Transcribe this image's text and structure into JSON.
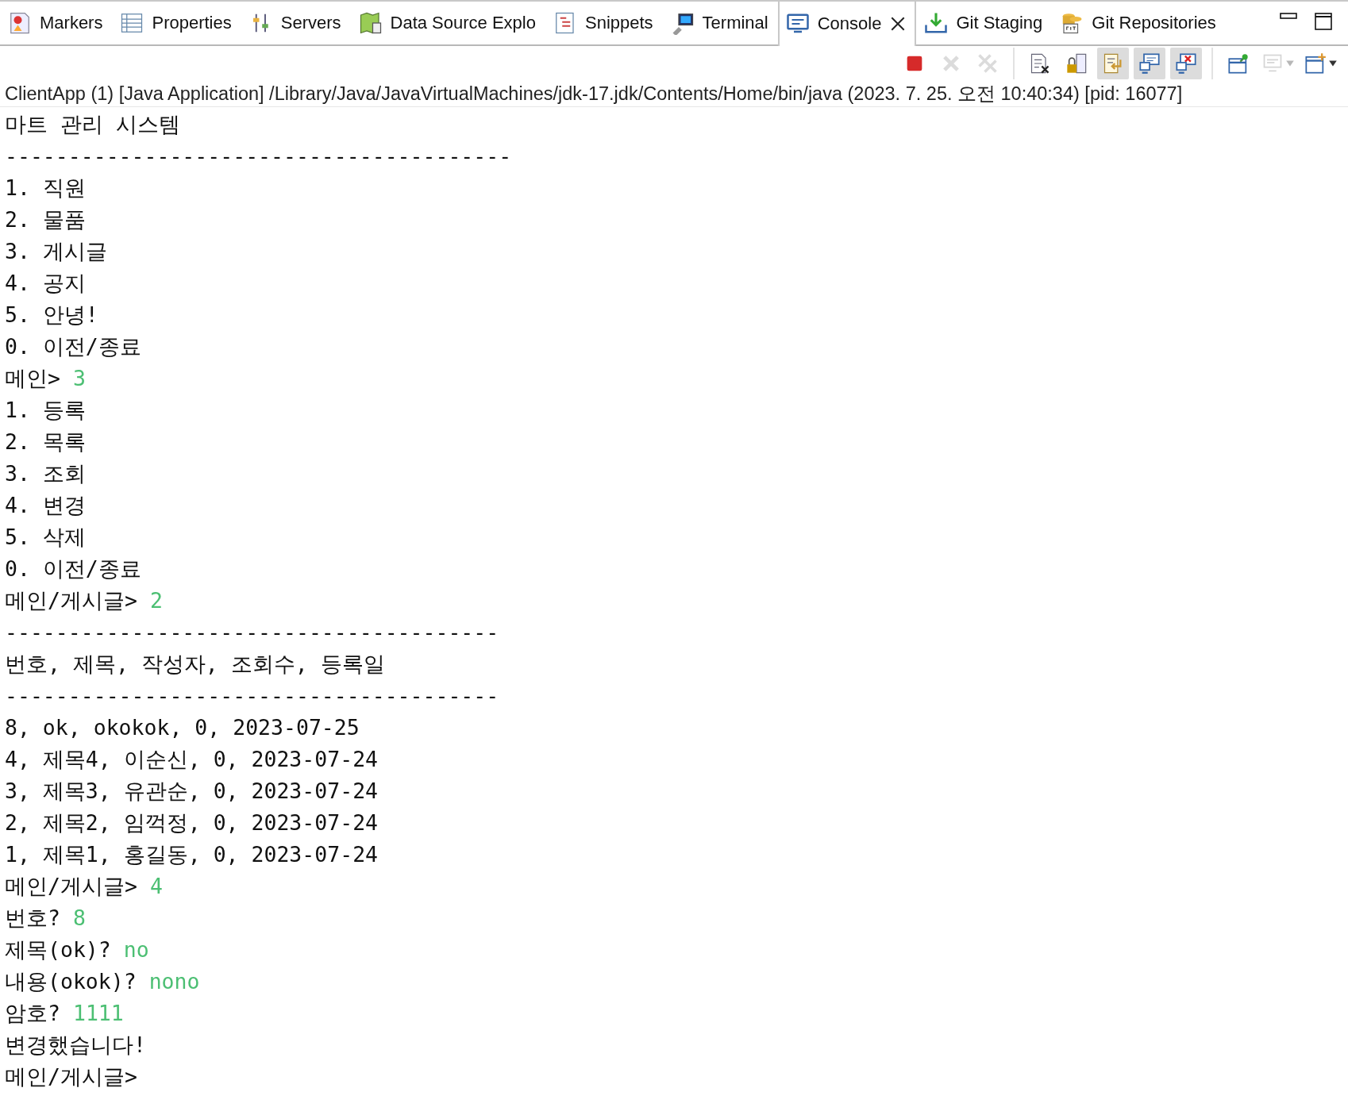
{
  "tabs": [
    {
      "label": "Markers",
      "selected": false
    },
    {
      "label": "Properties",
      "selected": false
    },
    {
      "label": "Servers",
      "selected": false
    },
    {
      "label": "Data Source Explo",
      "selected": false
    },
    {
      "label": "Snippets",
      "selected": false
    },
    {
      "label": "Terminal",
      "selected": false
    },
    {
      "label": "Console",
      "selected": true
    },
    {
      "label": "Git Staging",
      "selected": false
    },
    {
      "label": "Git Repositories",
      "selected": false
    }
  ],
  "toolbar": [
    {
      "disabled": false,
      "pressed": false
    },
    {
      "disabled": true,
      "pressed": false
    },
    {
      "disabled": true,
      "pressed": false
    },
    {
      "disabled": false,
      "pressed": false
    },
    {
      "disabled": false,
      "pressed": false
    },
    {
      "disabled": false,
      "pressed": true
    },
    {
      "disabled": false,
      "pressed": true
    },
    {
      "disabled": false,
      "pressed": true
    },
    {
      "disabled": false,
      "pressed": false
    },
    {
      "disabled": true,
      "pressed": false
    },
    {
      "disabled": false,
      "pressed": false
    }
  ],
  "console": {
    "header": "ClientApp (1) [Java Application] /Library/Java/JavaVirtualMachines/jdk-17.jdk/Contents/Home/bin/java  (2023. 7. 25. 오전 10:40:34) [pid: 16077]",
    "lines": [
      {
        "text": "마트 관리 시스템"
      },
      {
        "text": "----------------------------------------"
      },
      {
        "text": "1. 직원"
      },
      {
        "text": "2. 물품"
      },
      {
        "text": "3. 게시글"
      },
      {
        "text": "4. 공지"
      },
      {
        "text": "5. 안녕!"
      },
      {
        "text": "0. 이전/종료"
      },
      {
        "text": "메인>",
        "input": "3"
      },
      {
        "text": "1. 등록"
      },
      {
        "text": "2. 목록"
      },
      {
        "text": "3. 조회"
      },
      {
        "text": "4. 변경"
      },
      {
        "text": "5. 삭제"
      },
      {
        "text": "0. 이전/종료"
      },
      {
        "text": "메인/게시글>",
        "input": "2"
      },
      {
        "text": "---------------------------------------"
      },
      {
        "text": "번호, 제목, 작성자, 조회수, 등록일"
      },
      {
        "text": "---------------------------------------"
      },
      {
        "text": "8, ok, okokok, 0, 2023-07-25"
      },
      {
        "text": "4, 제목4, 이순신, 0, 2023-07-24"
      },
      {
        "text": "3, 제목3, 유관순, 0, 2023-07-24"
      },
      {
        "text": "2, 제목2, 임꺽정, 0, 2023-07-24"
      },
      {
        "text": "1, 제목1, 홍길동, 0, 2023-07-24"
      },
      {
        "text": "메인/게시글>",
        "input": "4"
      },
      {
        "text": "번호?",
        "input": "8"
      },
      {
        "text": "제목(ok)?",
        "input": "no"
      },
      {
        "text": "내용(okok)?",
        "input": "nono"
      },
      {
        "text": "암호?",
        "input": "1111"
      },
      {
        "text": "변경했습니다!"
      },
      {
        "text": "메인/게시글>"
      }
    ]
  }
}
